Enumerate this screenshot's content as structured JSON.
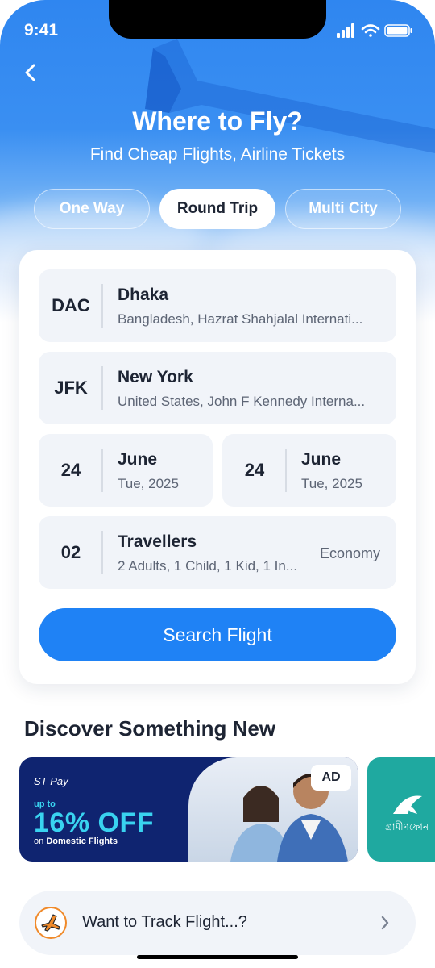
{
  "status": {
    "time": "9:41"
  },
  "header": {
    "title": "Where to Fly?",
    "subtitle": "Find Cheap Flights, Airline Tickets"
  },
  "trip_tabs": [
    {
      "label": "One Way",
      "active": false
    },
    {
      "label": "Round Trip",
      "active": true
    },
    {
      "label": "Multi City",
      "active": false
    }
  ],
  "form": {
    "from": {
      "code": "DAC",
      "city": "Dhaka",
      "detail": "Bangladesh, Hazrat Shahjalal Internati..."
    },
    "to": {
      "code": "JFK",
      "city": "New York",
      "detail": "United States, John F Kennedy Interna..."
    },
    "depart": {
      "day": "24",
      "month": "June",
      "detail": "Tue, 2025"
    },
    "return": {
      "day": "24",
      "month": "June",
      "detail": "Tue, 2025"
    },
    "travellers": {
      "count": "02",
      "label": "Travellers",
      "detail": "2 Adults, 1 Child, 1 Kid, 1 In...",
      "cabin": "Economy"
    },
    "search_label": "Search Flight"
  },
  "discover": {
    "title": "Discover Something New",
    "banners": [
      {
        "brand": "ST Pay",
        "upto": "up to",
        "offer": "16% OFF",
        "on_prefix": "on",
        "on_bold": "Domestic Flights",
        "badge": "AD"
      },
      {
        "brand_text": "গ্রামীণফোন"
      }
    ]
  },
  "track": {
    "label": "Want to Track Flight...?"
  },
  "colors": {
    "primary": "#1f82f5",
    "text": "#1d2433",
    "field_bg": "#f1f4f9",
    "offer": "#39d3f0"
  },
  "icons": [
    "back-arrow-icon",
    "signal-icon",
    "wifi-icon",
    "battery-icon",
    "plane-icon",
    "chevron-right-icon"
  ]
}
